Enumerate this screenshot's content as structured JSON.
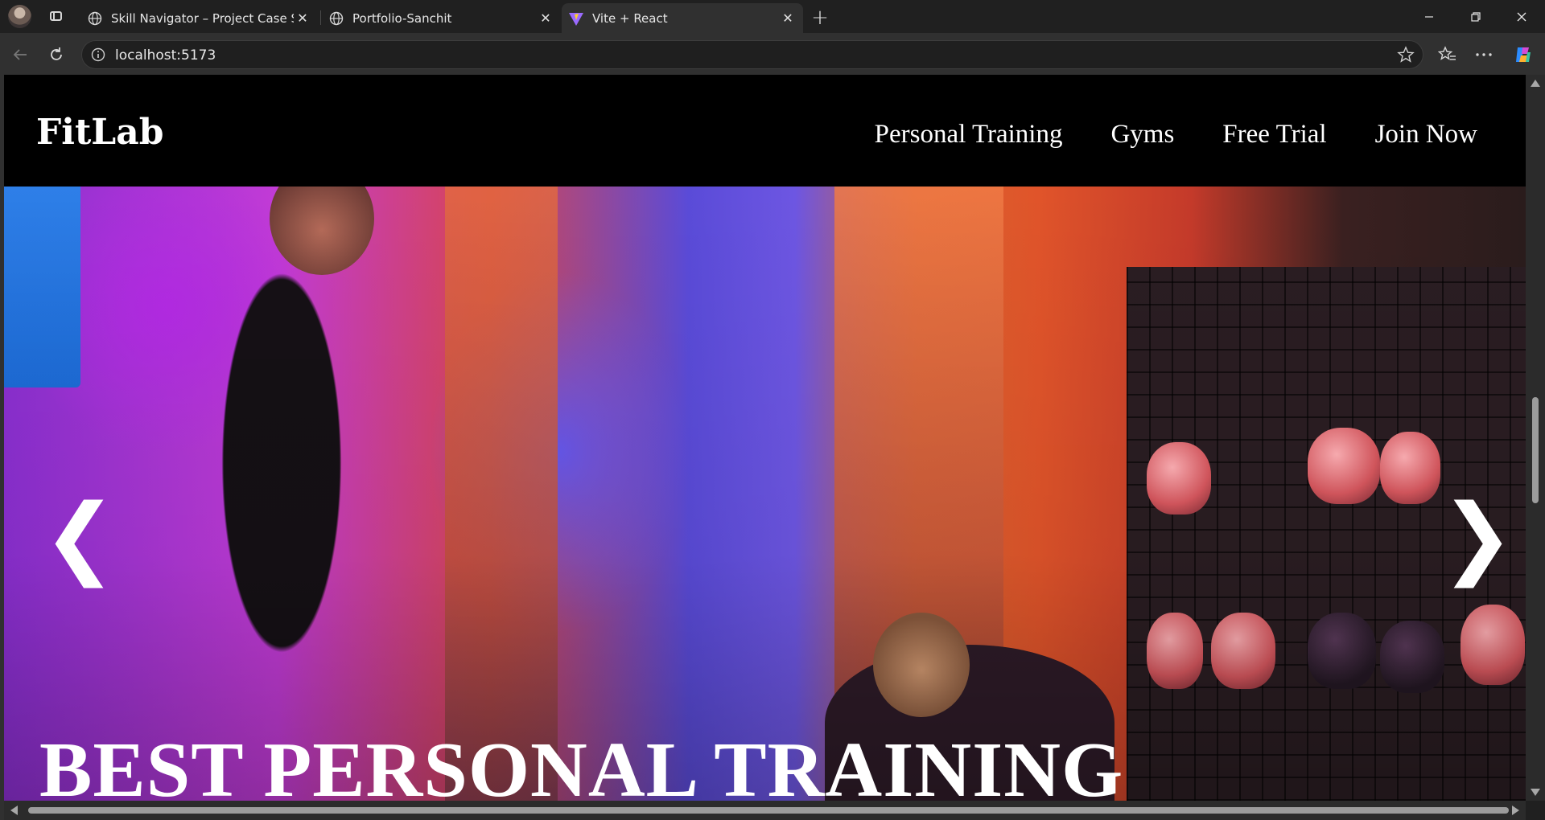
{
  "browser": {
    "tabs": [
      {
        "label": "Skill Navigator – Project Case Stud",
        "icon": "globe-icon",
        "active": false
      },
      {
        "label": "Portfolio-Sanchit",
        "icon": "globe-icon",
        "active": false
      },
      {
        "label": "Vite + React",
        "icon": "vite-icon",
        "active": true
      }
    ],
    "new_tab_label": "+",
    "url": "localhost:5173",
    "window_controls": {
      "minimize": "—",
      "restore": "❐",
      "close": "✕"
    }
  },
  "page": {
    "logo": "FitLab",
    "nav": [
      "Personal Training",
      "Gyms",
      "Free Trial",
      "Join Now"
    ],
    "hero": {
      "title": "BEST PERSONAL TRAINING",
      "prev_arrow": "❮",
      "next_arrow": "❯"
    }
  }
}
